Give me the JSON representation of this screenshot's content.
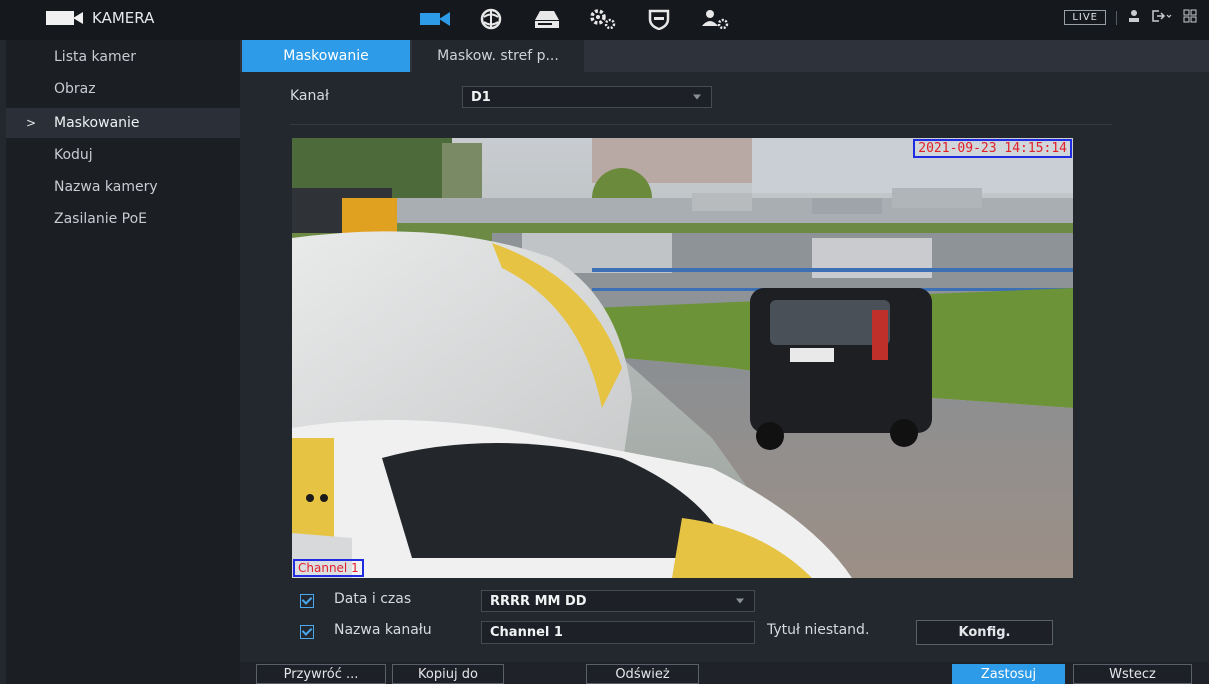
{
  "app": {
    "title": "KAMERA"
  },
  "top_icons": [
    "camera-icon",
    "network-globe-icon",
    "storage-icon",
    "system-settings-icon",
    "security-shield-icon",
    "account-settings-icon"
  ],
  "top_right": {
    "live": "LIVE"
  },
  "sidebar": {
    "items": [
      {
        "label": "Lista kamer",
        "active": false
      },
      {
        "label": "Obraz",
        "active": false
      },
      {
        "label": "Maskowanie",
        "active": true,
        "marker": ">"
      },
      {
        "label": "Koduj",
        "active": false
      },
      {
        "label": "Nazwa kamery",
        "active": false
      },
      {
        "label": "Zasilanie PoE",
        "active": false
      }
    ]
  },
  "tabs": [
    {
      "label": "Maskowanie",
      "active": true
    },
    {
      "label": "Maskow. stref p...",
      "active": false
    }
  ],
  "channel": {
    "label": "Kanał",
    "value": "D1"
  },
  "video": {
    "osd_datetime": "2021-09-23 14:15:14",
    "osd_channel": "Channel 1"
  },
  "options": {
    "datetime": {
      "label": "Data i czas",
      "checked": true,
      "format": "RRRR MM DD"
    },
    "channel_name": {
      "label": "Nazwa kanału",
      "checked": true,
      "value": "Channel 1"
    },
    "custom_title": {
      "label": "Tytuł niestand.",
      "button": "Konfig."
    }
  },
  "footer": {
    "restore": "Przywróć ...",
    "copy": "Kopiuj do",
    "refresh": "Odśwież",
    "apply": "Zastosuj",
    "back": "Wstecz"
  },
  "colors": {
    "accent": "#2d9be8",
    "osd_border": "#1f2ce0",
    "osd_text": "#e0202a"
  }
}
